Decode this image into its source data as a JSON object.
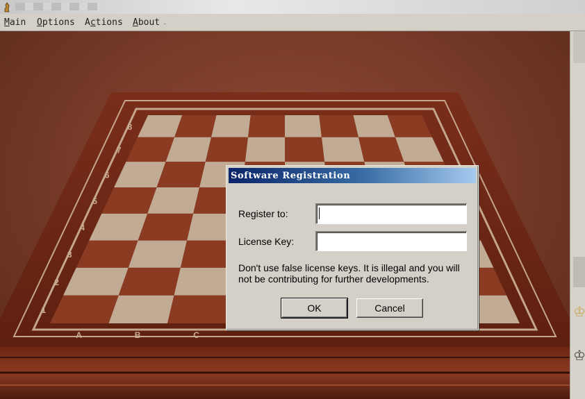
{
  "menu": {
    "items": [
      {
        "hotkey": "M",
        "rest": "ain"
      },
      {
        "hotkey": "O",
        "rest": "ptions"
      },
      {
        "hotkey": "c",
        "pre": "A",
        "rest": "tions"
      },
      {
        "hotkey": "A",
        "rest": "bout"
      }
    ]
  },
  "board": {
    "files": [
      "A",
      "B",
      "C"
    ],
    "ranks": [
      "1",
      "2",
      "3",
      "4",
      "5",
      "6",
      "7",
      "8"
    ]
  },
  "dialog": {
    "title": "Software Registration",
    "register_label": "Register to:",
    "register_value": "",
    "license_label": "License Key:",
    "license_value": "",
    "note": "Don't use false license keys. It is illegal and you will not be contributing for further developments.",
    "ok_label": "OK",
    "cancel_label": "Cancel"
  },
  "colors": {
    "title_start": "#0a246a",
    "title_end": "#a6caf0",
    "board_dark": "#8a3b22",
    "board_light": "#c2ab94"
  }
}
